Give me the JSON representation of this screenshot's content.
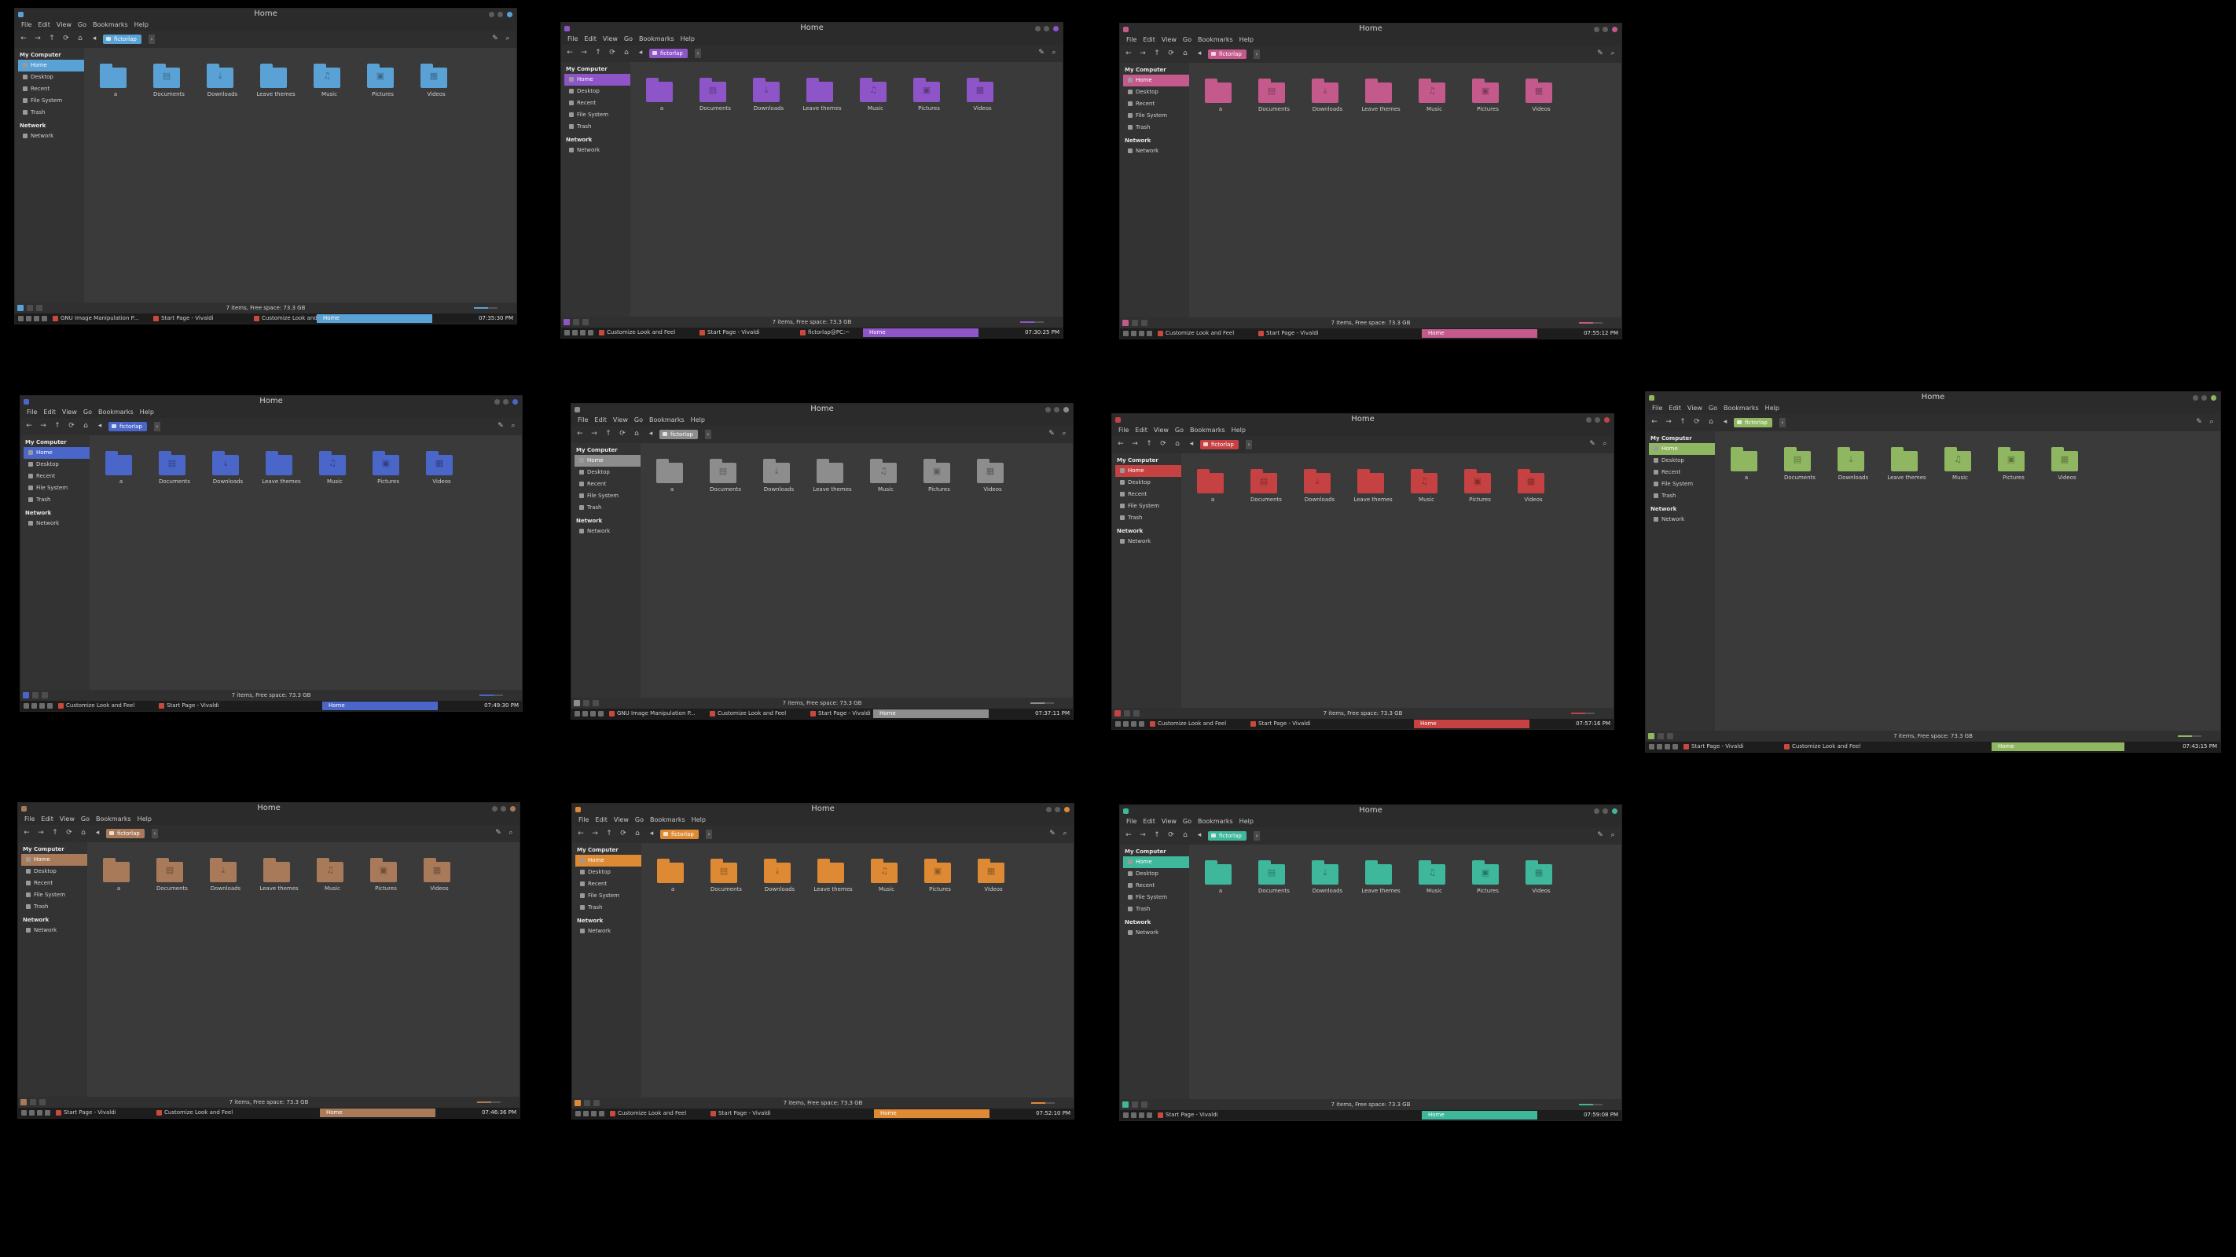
{
  "menu": [
    "File",
    "Edit",
    "View",
    "Go",
    "Bookmarks",
    "Help"
  ],
  "window_title": "Home",
  "breadcrumb": "fictorlap",
  "sidebar": {
    "section_computer": "My Computer",
    "items": [
      "Home",
      "Desktop",
      "Recent",
      "File System",
      "Trash"
    ],
    "section_network": "Network",
    "network_items": [
      "Network"
    ]
  },
  "folders": [
    "a",
    "Documents",
    "Downloads",
    "Leave themes",
    "Music",
    "Pictures",
    "Videos"
  ],
  "folder_glyphs": [
    "",
    "▤",
    "⤓",
    "",
    "♫",
    "▣",
    "▦"
  ],
  "panel_home_label": "Home",
  "screens": [
    {
      "accent": "#5aa2d6",
      "status": "7 items, Free space: 73.3 GB",
      "tasks": [
        "GNU Image Manipulation P...",
        "Start Page - Vivaldi",
        "Customize Look and Feel"
      ],
      "clock": "07:35:30 PM"
    },
    {
      "accent": "#8e55c8",
      "status": "7 items, Free space: 73.3 GB",
      "tasks": [
        "Customize Look and Feel",
        "Start Page - Vivaldi",
        "fictorlap@PC:~"
      ],
      "clock": "07:30:25 PM"
    },
    {
      "accent": "#c45a8c",
      "status": "7 items, Free space: 73.3 GB",
      "tasks": [
        "Customize Look and Feel",
        "Start Page - Vivaldi"
      ],
      "clock": "07:55:12 PM"
    },
    {
      "accent": "#4a66c9",
      "status": "7 items, Free space: 73.3 GB",
      "tasks": [
        "Customize Look and Feel",
        "Start Page - Vivaldi"
      ],
      "clock": "07:49:30 PM"
    },
    {
      "accent": "#8d8d8d",
      "status": "7 items, Free space: 73.3 GB",
      "tasks": [
        "GNU Image Manipulation P...",
        "Customize Look and Feel",
        "Start Page - Vivaldi"
      ],
      "clock": "07:37:11 PM"
    },
    {
      "accent": "#c64242",
      "status": "7 items, Free space: 73.3 GB",
      "tasks": [
        "Customize Look and Feel",
        "Start Page - Vivaldi"
      ],
      "clock": "07:57:16 PM"
    },
    {
      "accent": "#8fb660",
      "status": "7 items, Free space: 73.3 GB",
      "tasks": [
        "Start Page - Vivaldi",
        "Customize Look and Feel"
      ],
      "clock": "07:43:15 PM"
    },
    {
      "accent": "#a87a5a",
      "status": "7 items, Free space: 73.3 GB",
      "tasks": [
        "Start Page - Vivaldi",
        "Customize Look and Feel"
      ],
      "clock": "07:46:36 PM"
    },
    {
      "accent": "#de8a34",
      "status": "7 items, Free space: 73.3 GB",
      "tasks": [
        "Customize Look and Feel",
        "Start Page - Vivaldi"
      ],
      "clock": "07:52:10 PM"
    },
    {
      "accent": "#3fb79b",
      "status": "7 items, Free space: 73.3 GB",
      "tasks": [
        "Start Page - Vivaldi"
      ],
      "clock": "07:59:08 PM"
    }
  ]
}
